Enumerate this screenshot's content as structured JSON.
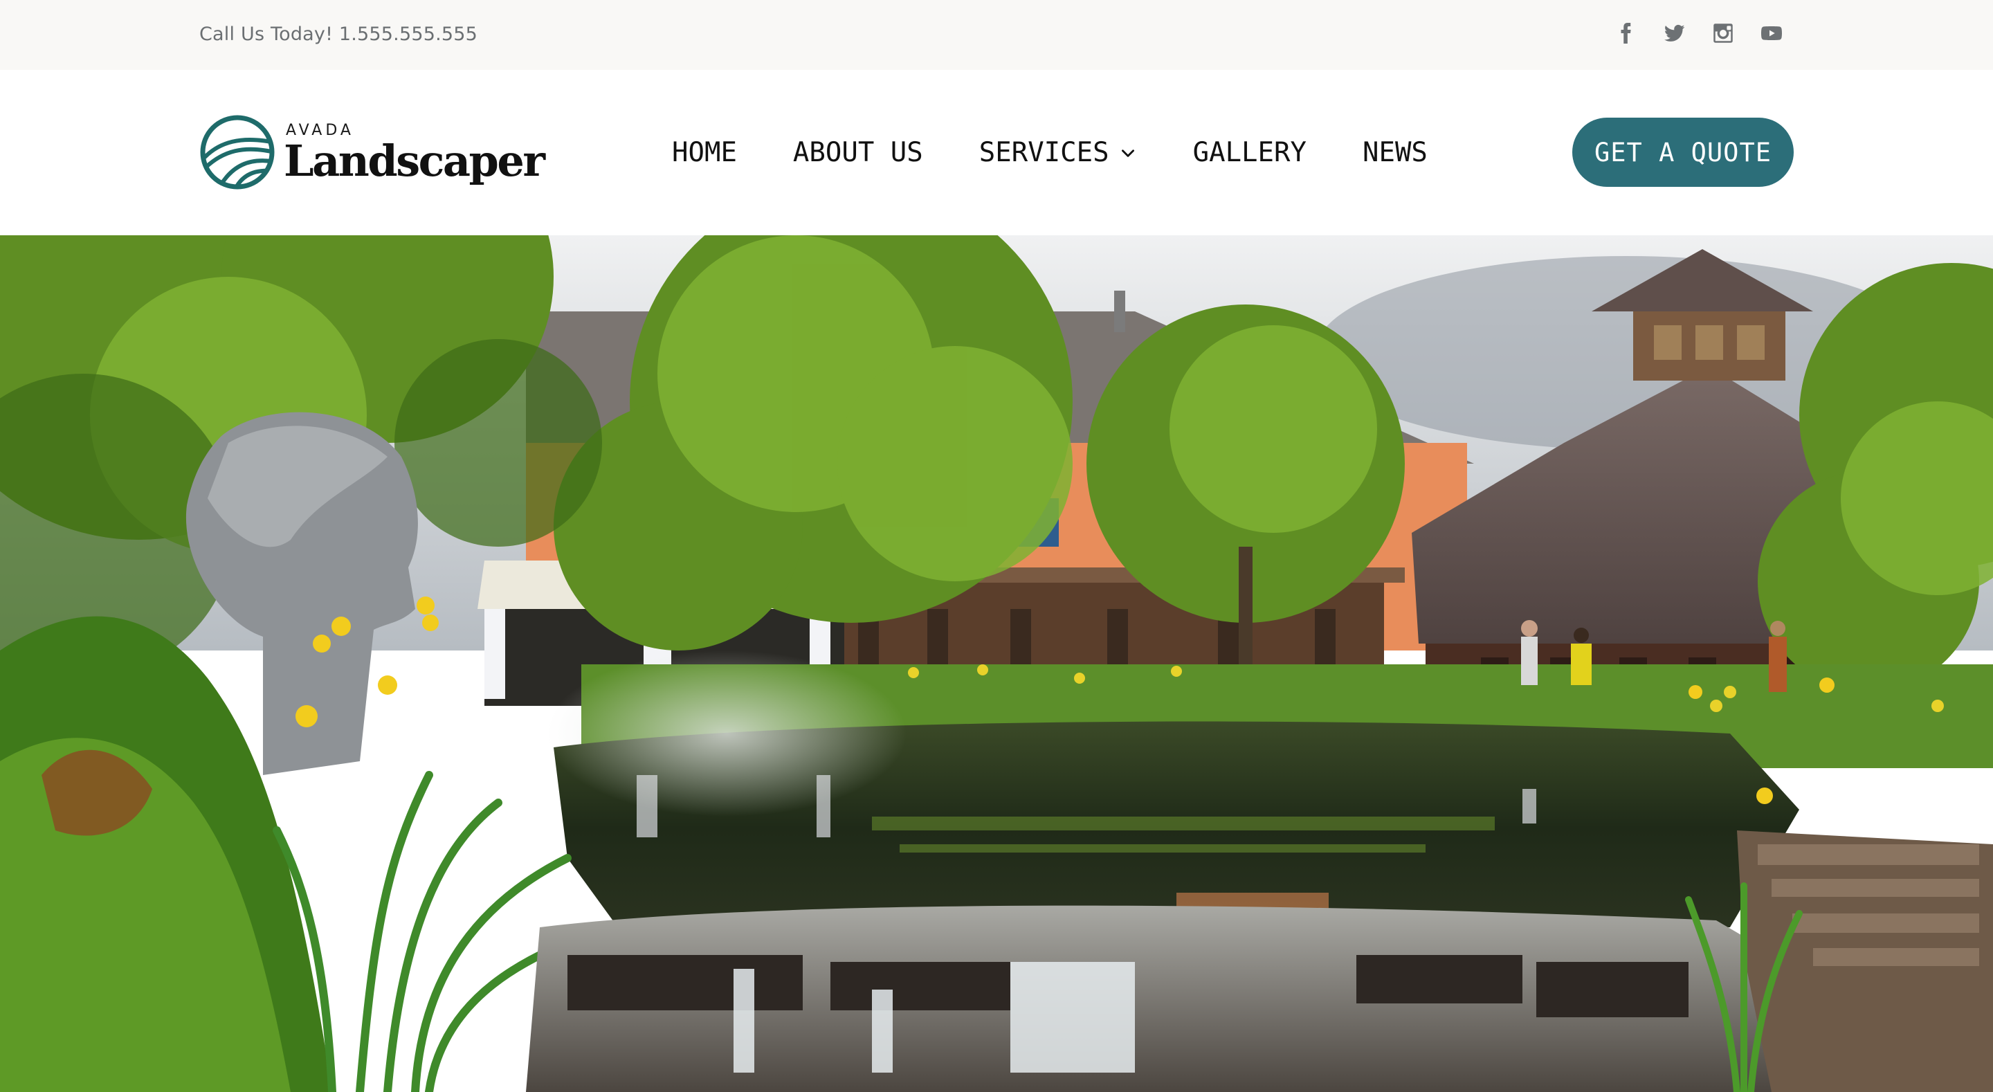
{
  "topbar": {
    "phone_text": "Call Us Today! 1.555.555.555",
    "social_icons": [
      "facebook-icon",
      "twitter-icon",
      "instagram-icon",
      "youtube-icon"
    ]
  },
  "logo": {
    "small_text": "AVADA",
    "big_text": "Landscaper",
    "color": "#1e6b6a"
  },
  "nav": {
    "items": [
      {
        "label": "HOME"
      },
      {
        "label": "ABOUT US"
      },
      {
        "label": "SERVICES",
        "has_dropdown": true
      },
      {
        "label": "GALLERY"
      },
      {
        "label": "NEWS"
      }
    ]
  },
  "cta": {
    "label": "GET A QUOTE",
    "color": "#2c6e79"
  },
  "hero": {
    "image_icon": "garden-pond-photo"
  }
}
